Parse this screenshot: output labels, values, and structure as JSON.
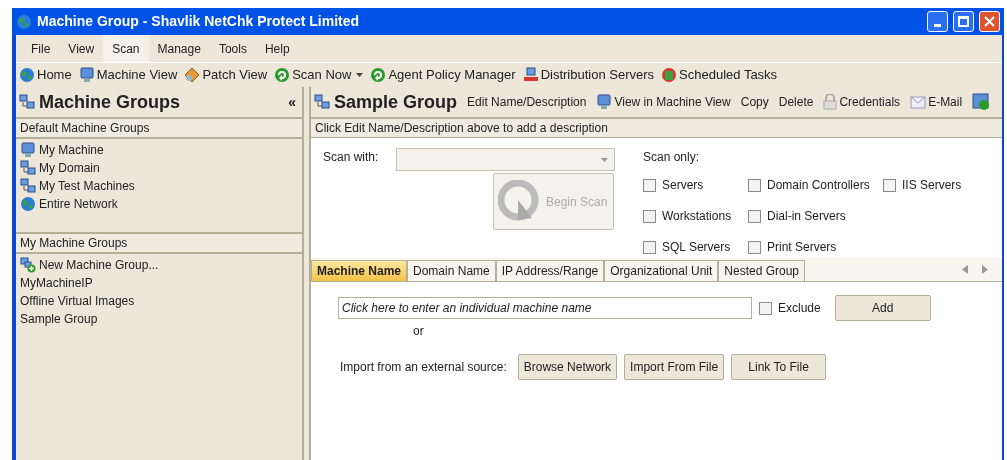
{
  "window": {
    "title": "Machine Group - Shavlik NetChk Protect Limited"
  },
  "menu": [
    {
      "label": "File",
      "selected": false
    },
    {
      "label": "View",
      "selected": false
    },
    {
      "label": "Scan",
      "selected": true
    },
    {
      "label": "Manage",
      "selected": false
    },
    {
      "label": "Tools",
      "selected": false
    },
    {
      "label": "Help",
      "selected": false
    }
  ],
  "toolbar": [
    {
      "label": "Home",
      "kind": "globe"
    },
    {
      "label": "Machine View",
      "kind": "monitor"
    },
    {
      "label": "Patch View",
      "kind": "patch"
    },
    {
      "label": "Scan Now",
      "kind": "scan",
      "dropdown": true
    },
    {
      "label": "Agent Policy Manager",
      "kind": "scan"
    },
    {
      "label": "Distribution Servers",
      "kind": "servers"
    },
    {
      "label": "Scheduled Tasks",
      "kind": "tasks"
    }
  ],
  "sidebar": {
    "title": "Machine Groups",
    "collapse": "«",
    "sections": [
      {
        "title": "Default Machine Groups",
        "items": [
          {
            "label": "My Machine",
            "kind": "monitor"
          },
          {
            "label": "My Domain",
            "kind": "network"
          },
          {
            "label": "My Test Machines",
            "kind": "network"
          },
          {
            "label": "Entire Network",
            "kind": "globe"
          }
        ]
      },
      {
        "title": "My Machine Groups",
        "items": [
          {
            "label": "New Machine Group...",
            "kind": "add"
          },
          {
            "label": "MyMachineIP"
          },
          {
            "label": "Offline Virtual Images"
          },
          {
            "label": "Sample Group"
          }
        ]
      }
    ]
  },
  "group": {
    "title": "Sample Group",
    "actions": [
      {
        "label": "Edit Name/Description"
      },
      {
        "label": "View in Machine View",
        "kind": "monitor"
      },
      {
        "label": "Copy"
      },
      {
        "label": "Delete"
      },
      {
        "label": "Credentials",
        "kind": "lock"
      },
      {
        "label": "E-Mail",
        "kind": "mail"
      },
      {
        "kind": "help"
      }
    ],
    "description": "Click Edit Name/Description above to add a description"
  },
  "scan": {
    "scan_with_label": "Scan with:",
    "begin_button": {
      "label": "Begin Scan",
      "disabled": true
    },
    "scan_only_label": "Scan only:",
    "options": [
      {
        "label": "Servers",
        "checked": false
      },
      {
        "label": "Domain Controllers",
        "checked": false
      },
      {
        "label": "IIS Servers",
        "checked": false
      },
      {
        "label": "Workstations",
        "checked": false
      },
      {
        "label": "Dial-in Servers",
        "checked": false
      },
      {
        "label": "SQL Servers",
        "checked": false
      },
      {
        "label": "Print Servers",
        "checked": false
      }
    ]
  },
  "tabs": [
    {
      "label": "Machine Name",
      "selected": true
    },
    {
      "label": "Domain Name",
      "selected": false
    },
    {
      "label": "IP Address/Range",
      "selected": false
    },
    {
      "label": "Organizational Unit",
      "selected": false
    },
    {
      "label": "Nested Group",
      "selected": false
    }
  ],
  "machine": {
    "placeholder": "Click here to enter an individual machine name",
    "exclude": {
      "label": "Exclude",
      "checked": false
    },
    "add_button": "Add",
    "or": "or",
    "import_label": "Import from an external source:",
    "import_buttons": [
      "Browse Network",
      "Import From File",
      "Link To File"
    ]
  }
}
